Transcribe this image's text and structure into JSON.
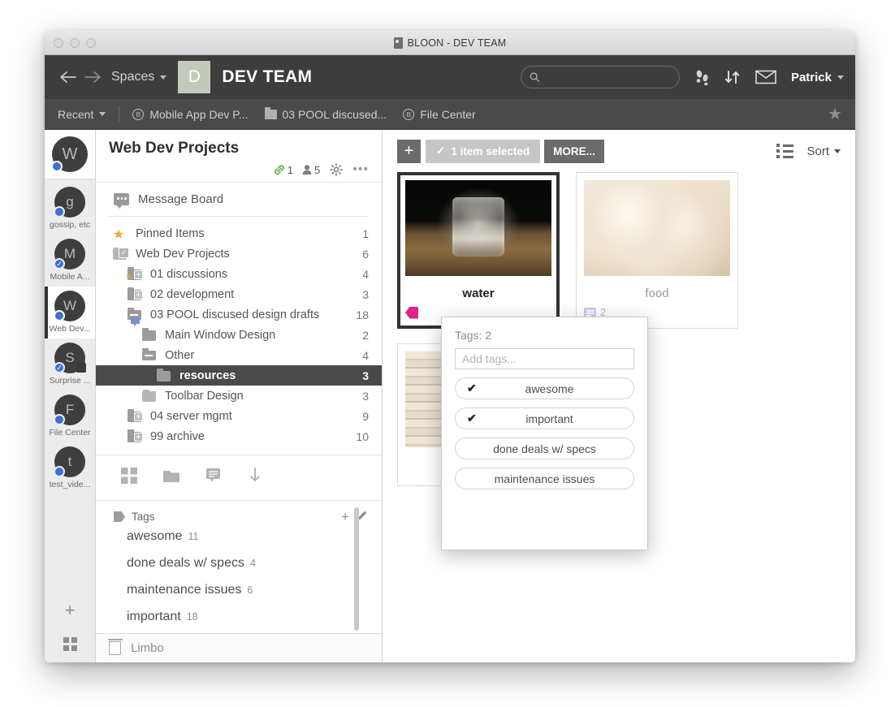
{
  "window": {
    "title": "BLOON - DEV TEAM",
    "app_icon": "app-icon"
  },
  "topnav": {
    "back_icon": "arrow-left-icon",
    "forward_icon": "arrow-right-icon",
    "spaces_label": "Spaces",
    "team_initial": "D",
    "team_name": "DEV TEAM",
    "search": {
      "value": "",
      "placeholder": ""
    },
    "activity_icon": "footsteps-icon",
    "transfer_icon": "sort-updown-icon",
    "mail_icon": "envelope-icon",
    "user_label": "Patrick"
  },
  "crumbbar": {
    "recent_label": "Recent",
    "items": [
      {
        "label": "Mobile App Dev P...",
        "icon": "bubble-b-icon"
      },
      {
        "label": "03 POOL discused...",
        "icon": "folder-icon"
      },
      {
        "label": "File Center",
        "icon": "bubble-b-icon"
      }
    ],
    "favorite_icon": "star-icon"
  },
  "rail": {
    "current": {
      "initial": "W",
      "status": "online"
    },
    "items": [
      {
        "initial": "g",
        "label": "gossip, etc",
        "status": "online",
        "active": false,
        "locked": false
      },
      {
        "initial": "M",
        "label": "Mobile A...",
        "status": "check",
        "active": false,
        "locked": false
      },
      {
        "initial": "W",
        "label": "Web Dev...",
        "status": "online",
        "active": true,
        "locked": false
      },
      {
        "initial": "S",
        "label": "Surprise ...",
        "status": "check",
        "active": false,
        "locked": true
      },
      {
        "initial": "F",
        "label": "File Center",
        "status": "online",
        "active": false,
        "locked": false
      },
      {
        "initial": "t",
        "label": "test_vide...",
        "status": "online",
        "active": false,
        "locked": false
      }
    ],
    "add_icon": "plus-icon",
    "apps_icon": "grid-icon"
  },
  "tree": {
    "title": "Web Dev Projects",
    "meta": {
      "links_count": "1",
      "members_count": "5",
      "settings_icon": "gear-icon",
      "more_icon": "ellipsis-icon"
    },
    "message_board_label": "Message Board",
    "rows": [
      {
        "label": "Pinned Items",
        "count": "1",
        "indent": 0,
        "icon": "star-icon",
        "selected": false
      },
      {
        "label": "Web Dev Projects",
        "count": "6",
        "indent": 0,
        "icon": "folder-check-icon",
        "selected": false
      },
      {
        "label": "01 discussions",
        "count": "4",
        "indent": 1,
        "icon": "folder-plus-star-icon",
        "selected": false
      },
      {
        "label": "02 development",
        "count": "3",
        "indent": 1,
        "icon": "folder-plus-icon",
        "selected": false
      },
      {
        "label": "03 POOL discused design drafts",
        "count": "18",
        "indent": 1,
        "icon": "folder-open-blue-icon",
        "selected": false
      },
      {
        "label": "Main Window Design",
        "count": "2",
        "indent": 2,
        "icon": "folder-icon",
        "selected": false
      },
      {
        "label": "Other",
        "count": "4",
        "indent": 2,
        "icon": "folder-open-icon",
        "selected": false
      },
      {
        "label": "resources",
        "count": "3",
        "indent": 3,
        "icon": "folder-icon",
        "selected": true
      },
      {
        "label": "Toolbar Design",
        "count": "3",
        "indent": 2,
        "icon": "folder-icon",
        "selected": false
      },
      {
        "label": "04 server mgmt",
        "count": "9",
        "indent": 1,
        "icon": "folder-plus-icon",
        "selected": false
      },
      {
        "label": "99 archive",
        "count": "10",
        "indent": 1,
        "icon": "folder-plus-icon",
        "selected": false
      }
    ],
    "tools": [
      {
        "icon": "grid-icon"
      },
      {
        "icon": "folder-icon"
      },
      {
        "icon": "comment-icon"
      },
      {
        "icon": "download-icon"
      }
    ],
    "tags_section": {
      "label": "Tags",
      "add_icon": "plus-icon",
      "edit_icon": "pencil-icon",
      "items": [
        {
          "label": "awesome",
          "count": "11"
        },
        {
          "label": "done deals w/ specs",
          "count": "4"
        },
        {
          "label": "maintenance issues",
          "count": "6"
        },
        {
          "label": "important",
          "count": "18"
        }
      ]
    },
    "limbo_label": "Limbo",
    "limbo_icon": "trash-icon"
  },
  "content": {
    "add_icon": "plus-icon",
    "selected_label": "1 item selected",
    "selected_check_icon": "check-icon",
    "more_label": "MORE...",
    "view_icon": "list-view-icon",
    "sort_label": "Sort",
    "cards": [
      {
        "caption": "water",
        "thumb": "th-water",
        "selected": true,
        "tag_icon": "tag-icon",
        "comments": ""
      },
      {
        "caption": "food",
        "thumb": "th-food",
        "selected": false,
        "tag_icon": "",
        "comments": "2"
      },
      {
        "caption": "",
        "thumb": "th-wood",
        "selected": false,
        "tag_icon": "",
        "comments": ""
      }
    ]
  },
  "popup": {
    "title": "Tags: 2",
    "input": {
      "value": "",
      "placeholder": "Add tags..."
    },
    "tags": [
      {
        "label": "awesome",
        "checked": true
      },
      {
        "label": "important",
        "checked": true
      },
      {
        "label": "done deals w/ specs",
        "checked": false
      },
      {
        "label": "maintenance issues",
        "checked": false
      }
    ],
    "check_glyph": "✔"
  },
  "colors": {
    "topnav_bg": "#3d3d3d",
    "crumbbar_bg": "#4a4a4a",
    "team_badge_bg": "#c4cabb",
    "accent_blue": "#3f6fd0",
    "tag_pink": "#e0218a",
    "link_green": "#5aba47",
    "pin_orange": "#f0a830",
    "selected_row_bg": "#4a4a4a"
  }
}
